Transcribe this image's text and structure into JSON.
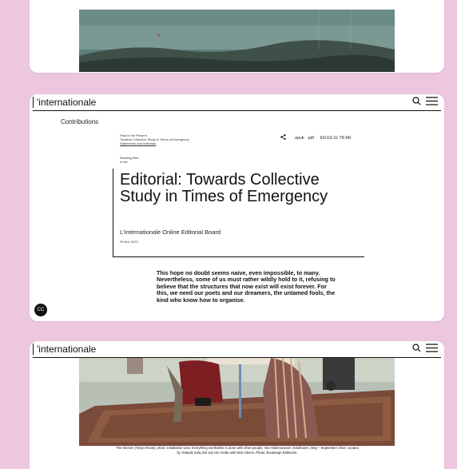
{
  "site": {
    "logo": "'internationale"
  },
  "article": {
    "section": "Contributions",
    "breadcrumb": [
      "Past in the Present",
      "Towards Collective Study in Times of Emergency",
      "Statements and editorials"
    ],
    "reading_time_label": "Reading time",
    "reading_time_value": "5 min",
    "share": {
      "epub": ".epub",
      "pdf": ".pdf",
      "languages": "EN ES SL TR AR"
    },
    "title": "Editorial: Towards Collective Study in Times of Emergency",
    "byline": "L'Internationale Online Editorial Board",
    "date": "29 Nov 2023",
    "quote": "This hope no doubt seems naive, even impossible, to many. Nevertheless, some of us must rather wildly hold to it, refusing to believe that the structures that now exist will exist forever. For this, we need our poets and our dreamers, the untamed fools, the kind who know how to organise."
  },
  "badge": "CC",
  "caption": {
    "line1": "The Kitchen (Tokyo Roots), 2023, installation view, Everything worthwhile is done with other people, Van Abbemuseum, Eindhoven, May – September 2023, curated",
    "line2": "by Yolande Zola Zoli van der Heide with Nick Aikens. Photo: Boudewijn Bollmann."
  },
  "icons": {
    "search": "search-icon",
    "menu": "menu-icon",
    "share": "share-icon",
    "cc": "creative-commons-icon"
  }
}
